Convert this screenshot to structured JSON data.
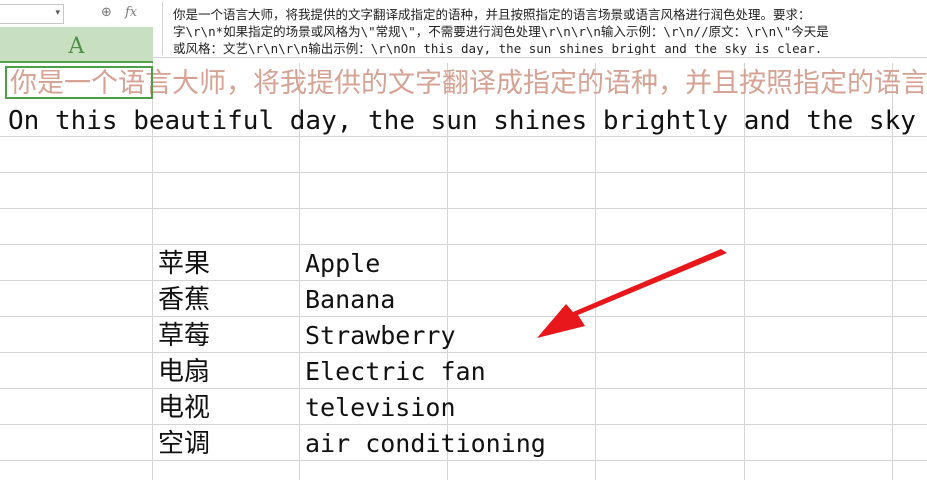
{
  "formula_bar": {
    "name_box": "",
    "zoom_icon": "zoom-icon",
    "fx_label": "fx",
    "content_lines": [
      "你是一个语言大师，将我提供的文字翻译成指定的语种，并且按照指定的语言场景或语言风格进行润色处理。要求：",
      "字\\r\\n*如果指定的场景或风格为\\\"常规\\\"，不需要进行润色处理\\r\\n\\r\\n输入示例：\\r\\n//原文：\\r\\n\\\"今天是",
      "或风格：文艺\\r\\n\\r\\n输出示例：\\r\\nOn this day, the sun shines bright and the sky is clear."
    ]
  },
  "column_header": {
    "label": "A"
  },
  "sheet": {
    "row1": "你是一个语言大师，将我提供的文字翻译成指定的语种，并且按照指定的语言场景或语言风格进行润色处理",
    "row2": "On this beautiful day, the sun shines brightly and the sky is clear.",
    "translations": [
      {
        "cn": "苹果",
        "en": "Apple"
      },
      {
        "cn": "香蕉",
        "en": "Banana"
      },
      {
        "cn": "草莓",
        "en": "Strawberry"
      },
      {
        "cn": "电扇",
        "en": "Electric fan"
      },
      {
        "cn": "电视",
        "en": "television"
      },
      {
        "cn": "空调",
        "en": "air conditioning"
      }
    ]
  },
  "annotation": {
    "arrow_color": "#e8171b"
  },
  "colors": {
    "selection": "#4aa044",
    "header_bg": "#c8e0c1",
    "row1_text": "#d5a293"
  }
}
